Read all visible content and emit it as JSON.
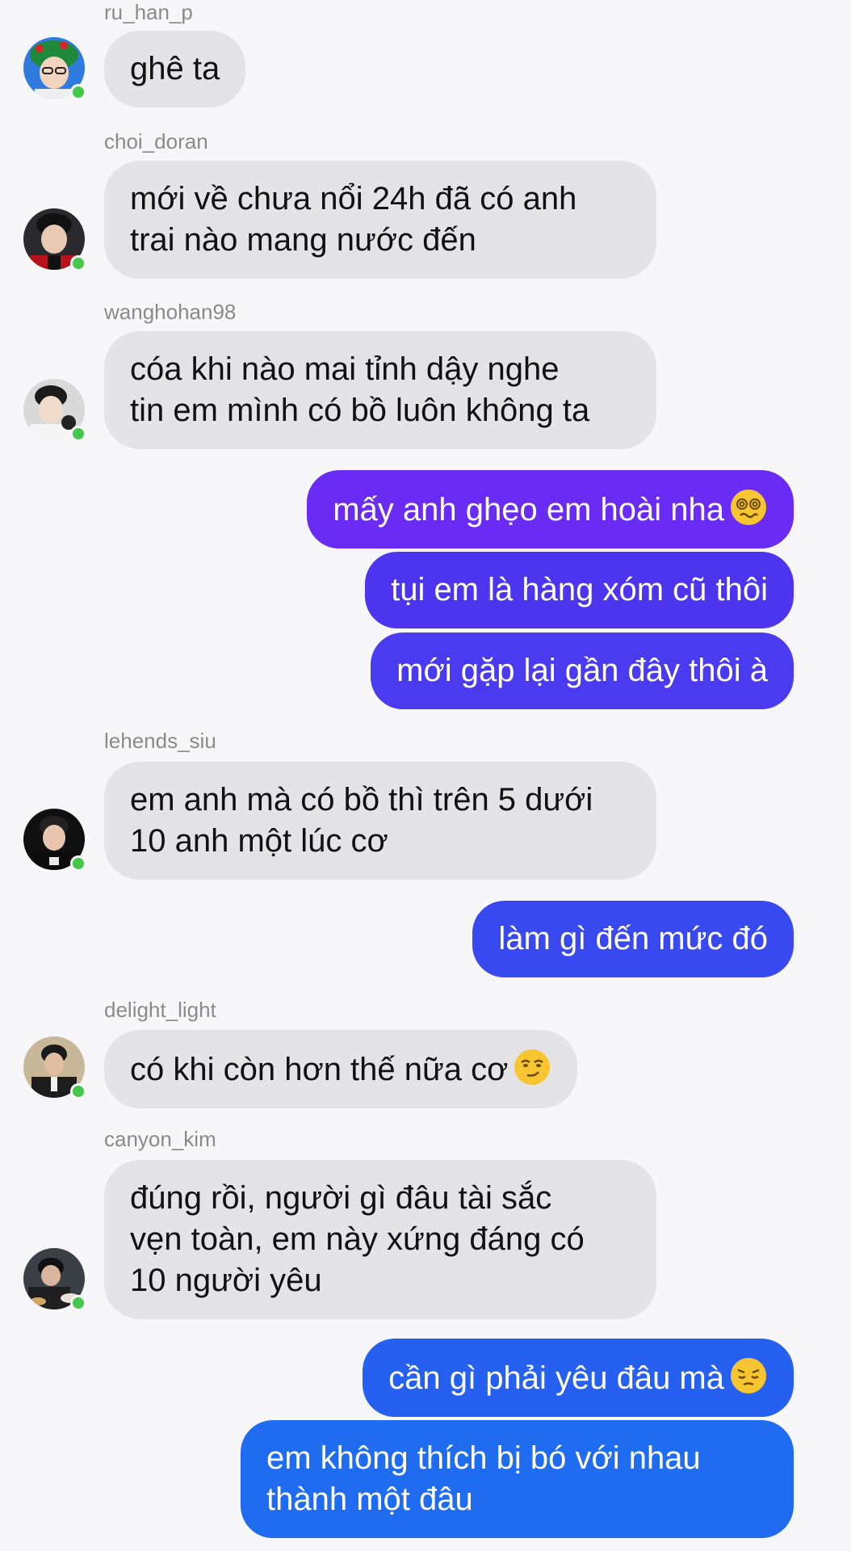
{
  "colors": {
    "incoming_bubble": "#e4e4e6",
    "outgoing_purple": "#6a2bf4",
    "outgoing_indigo": "#4d34ef",
    "outgoing_blue": "#1f6cf0",
    "online": "#44c74a"
  },
  "messages": [
    {
      "sender": "ru_han_p",
      "text": "ghê ta"
    },
    {
      "sender": "choi_doran",
      "text": "mới về chưa nổi 24h đã có anh\ntrai nào mang nước đến"
    },
    {
      "sender": "wanghohan98",
      "text": "cóa khi nào mai tỉnh dậy nghe\ntin em mình có bồ luôn không ta"
    },
    {
      "sender": "me",
      "text": "mấy anh ghẹo em hoài nha",
      "emoji": "dizzy-face-emoji"
    },
    {
      "sender": "me",
      "text": "tụi em là hàng xóm cũ thôi"
    },
    {
      "sender": "me",
      "text": "mới gặp lại gần đây thôi à"
    },
    {
      "sender": "lehends_siu",
      "text": "em anh mà có bồ thì trên 5 dưới\n10 anh một lúc cơ"
    },
    {
      "sender": "me",
      "text": "làm gì đến mức đó"
    },
    {
      "sender": "delight_light",
      "text": "có khi còn hơn thế nữa cơ",
      "emoji": "smirking-face-emoji"
    },
    {
      "sender": "canyon_kim",
      "text": "đúng rồi, người gì đâu tài sắc\nvẹn toàn, em này xứng đáng có\n10 người yêu"
    },
    {
      "sender": "me",
      "text": "cần gì phải yêu đâu mà",
      "emoji": "pensive-face-emoji"
    },
    {
      "sender": "me",
      "text": "em không thích bị bó với nhau\nthành một đâu"
    }
  ]
}
